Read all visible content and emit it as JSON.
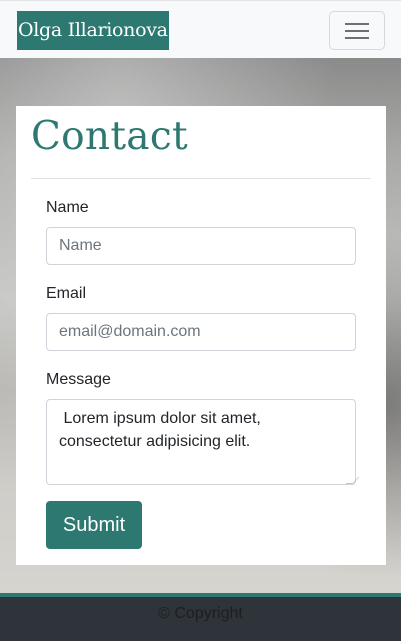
{
  "navbar": {
    "brand": "Olga Illarionova",
    "menu_icon": "hamburger-icon"
  },
  "contact": {
    "heading": "Contact",
    "name_label": "Name",
    "name_placeholder": "Name",
    "email_label": "Email",
    "email_placeholder": "email@domain.com",
    "message_label": "Message",
    "message_value": " Lorem ipsum dolor sit amet, consectetur adipisicing elit.",
    "submit_label": "Submit"
  },
  "footer": {
    "text": "© Copyright"
  },
  "colors": {
    "accent": "#2d7871",
    "footer_bg": "#2f343a",
    "navbar_bg": "#f8f9fa"
  }
}
